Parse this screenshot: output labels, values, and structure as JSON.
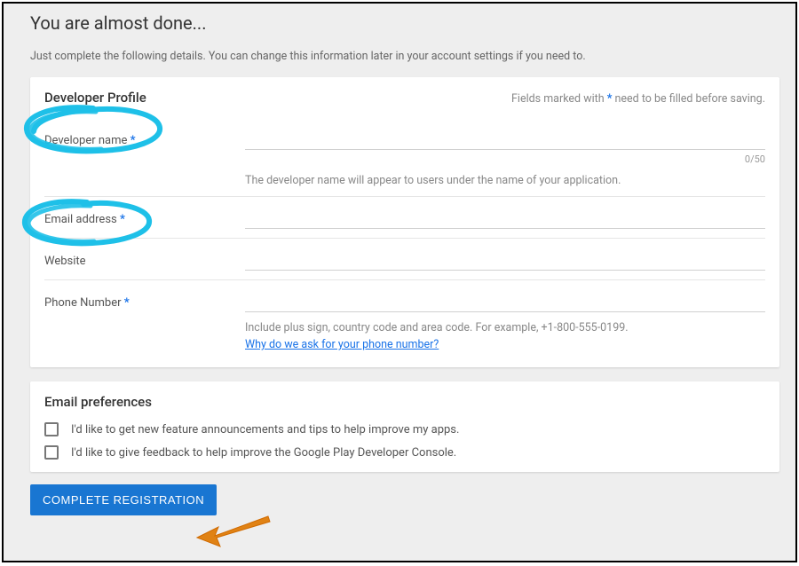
{
  "page": {
    "title": "You are almost done...",
    "subtitle": "Just complete the following details. You can change this information later in your account settings if you need to."
  },
  "profile": {
    "card_title": "Developer Profile",
    "required_prefix": "Fields marked with ",
    "required_suffix": " need to be filled before saving.",
    "dev_name_label": "Developer name",
    "dev_name_counter": "0/50",
    "dev_name_hint": "The developer name will appear to users under the name of your application.",
    "email_label": "Email address",
    "website_label": "Website",
    "phone_label": "Phone Number",
    "phone_hint": "Include plus sign, country code and area code. For example, +1-800-555-0199.",
    "phone_link": "Why do we ask for your phone number?"
  },
  "prefs": {
    "title": "Email preferences",
    "opt1": "I'd like to get new feature announcements and tips to help improve my apps.",
    "opt2": "I'd like to give feedback to help improve the Google Play Developer Console."
  },
  "button": {
    "complete": "COMPLETE REGISTRATION"
  },
  "asterisk": "*"
}
